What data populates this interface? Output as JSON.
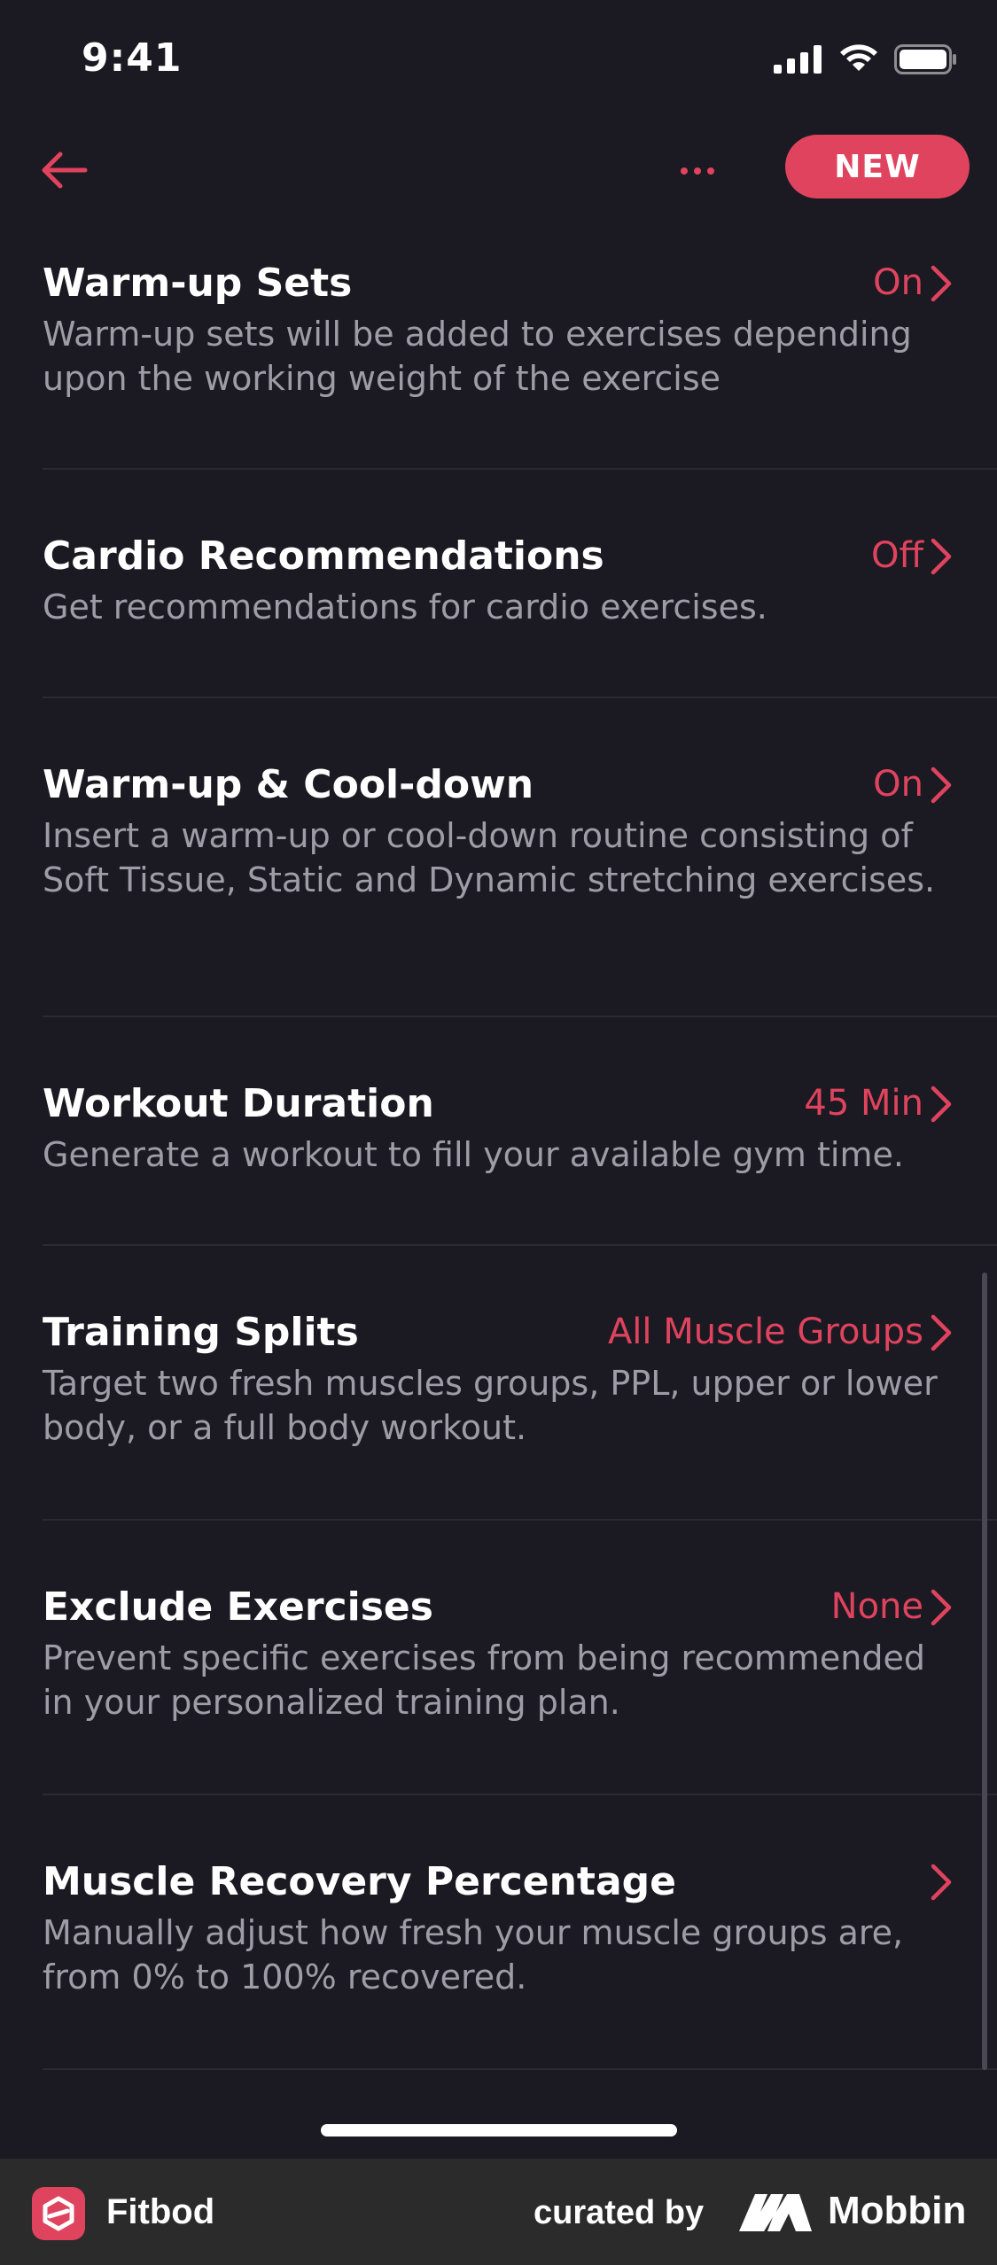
{
  "status_bar": {
    "time": "9:41"
  },
  "nav": {
    "new_label": "NEW",
    "icons": [
      "back-arrow-icon",
      "more-dots-icon"
    ],
    "accent_color": "#e0435e"
  },
  "settings": [
    {
      "title": "Warm-up Sets",
      "value": "On",
      "description": "Warm-up sets will be added to exercises depending upon the working weight of the exercise"
    },
    {
      "title": "Cardio Recommendations",
      "value": "Off",
      "description": "Get recommendations for cardio exercises."
    },
    {
      "title": "Warm-up & Cool-down",
      "value": "On",
      "description": "Insert a warm-up or cool-down routine consisting of Soft Tissue, Static and Dynamic stretching exercises."
    },
    {
      "title": "Workout Duration",
      "value": "45 Min",
      "description": "Generate a workout to fill your available gym time."
    },
    {
      "title": "Training Splits",
      "value": "All Muscle Groups",
      "description": "Target two fresh muscles groups, PPL, upper or lower body, or a full body workout."
    },
    {
      "title": "Exclude Exercises",
      "value": "None",
      "description": "Prevent specific exercises from being recommended in your personalized training plan."
    },
    {
      "title": "Muscle Recovery Percentage",
      "value": "",
      "description": "Manually adjust how fresh your muscle groups are, from 0% to 100% recovered."
    }
  ],
  "footer": {
    "app_name": "Fitbod",
    "curated_by": "curated by",
    "brand": "Mobbin"
  }
}
